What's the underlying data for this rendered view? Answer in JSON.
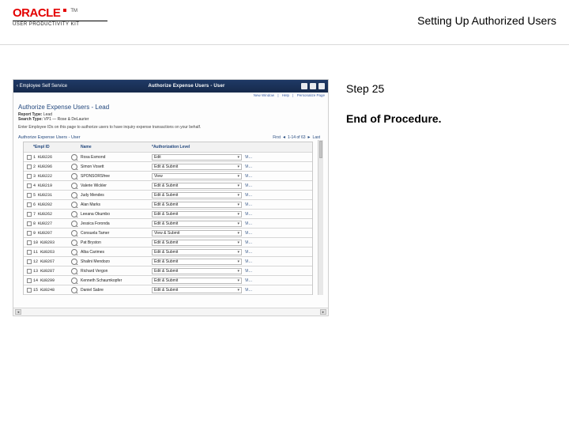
{
  "doc_title": "Setting Up Authorized Users",
  "brand": {
    "name": "ORACLE",
    "tm": "TM",
    "sub": "USER PRODUCTIVITY KIT"
  },
  "right": {
    "step": "Step 25",
    "end": "End of Procedure."
  },
  "app": {
    "titlebar": {
      "back": "‹  Employee Self Service",
      "center": "Authorize Expense Users - User"
    },
    "subbar_links": [
      "New Window",
      "Help",
      "Personalize Page"
    ],
    "page_h1": "Authorize Expense Users - Lead",
    "meta": {
      "report_type_lbl": "Report Type:",
      "report_type_val": "Lead",
      "search_type_lbl": "Search Type:",
      "search_type_val": "VP1 — Rose & DeLaurier"
    },
    "instr": "Enter Employee IDs on this page to authorize users to have inquiry expense transactions on your behalf.",
    "grid_title": "Authorize Expense Users - User",
    "grid_nav": {
      "first": "First",
      "range": "1-14 of 63",
      "last": "Last"
    },
    "columns": [
      "",
      "*Empl ID",
      "",
      "Name",
      "*Authorization Level",
      ""
    ],
    "rows": [
      {
        "n": "1",
        "id": "KU0226",
        "name": "Rosa Esmond",
        "level": "Edit"
      },
      {
        "n": "2",
        "id": "KU0206",
        "name": "Simon Vosett",
        "level": "Edit & Submit"
      },
      {
        "n": "3",
        "id": "KU0222",
        "name": "SPONSORSfree",
        "level": "View"
      },
      {
        "n": "4",
        "id": "KU0219",
        "name": "Valerie Wickler",
        "level": "Edit & Submit"
      },
      {
        "n": "5",
        "id": "KU0231",
        "name": "Judy Mendes",
        "level": "Edit & Submit"
      },
      {
        "n": "6",
        "id": "KU0202",
        "name": "Alan Marks",
        "level": "Edit & Submit"
      },
      {
        "n": "7",
        "id": "KU0262",
        "name": "Leeana Okumbo",
        "level": "Edit & Submit"
      },
      {
        "n": "8",
        "id": "KU0227",
        "name": "Jessica Foronda",
        "level": "Edit & Submit"
      },
      {
        "n": "9",
        "id": "KU0207",
        "name": "Consuela Tamer",
        "level": "View & Submit"
      },
      {
        "n": "10",
        "id": "KU0203",
        "name": "Pat Bryston",
        "level": "Edit & Submit"
      },
      {
        "n": "11",
        "id": "KU0263",
        "name": "Alba Carimes",
        "level": "Edit & Submit"
      },
      {
        "n": "12",
        "id": "KU0267",
        "name": "Shalini Mendozo",
        "level": "Edit & Submit"
      },
      {
        "n": "13",
        "id": "KU0287",
        "name": "Richard Vergon",
        "level": "Edit & Submit"
      },
      {
        "n": "14",
        "id": "KU0299",
        "name": "Kenneth Schaumkopfer",
        "level": "Edit & Submit"
      },
      {
        "n": "15",
        "id": "KU0248",
        "name": "Daniel Sabre",
        "level": "Edit & Submit"
      }
    ],
    "view_link": "View"
  }
}
